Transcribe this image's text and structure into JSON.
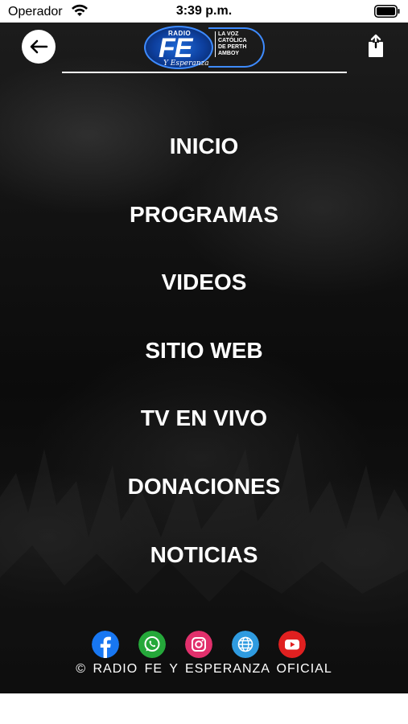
{
  "status_bar": {
    "carrier": "Operador",
    "time": "3:39 p.m."
  },
  "header": {
    "logo": {
      "radio": "RADIO",
      "fe": "FE",
      "esperanza": "Y Esperanza",
      "tagline": [
        "LA VOZ",
        "CATÓLICA",
        "DE PERTH",
        "AMBOY"
      ]
    }
  },
  "menu": {
    "items": [
      {
        "label": "INICIO"
      },
      {
        "label": "PROGRAMAS"
      },
      {
        "label": "VIDEOS"
      },
      {
        "label": "SITIO WEB"
      },
      {
        "label": "TV EN VIVO"
      },
      {
        "label": "DONACIONES"
      },
      {
        "label": "NOTICIAS"
      }
    ]
  },
  "social": [
    {
      "icon": "facebook-icon",
      "color": "#1877f2"
    },
    {
      "icon": "whatsapp-icon",
      "color": "#25a83a"
    },
    {
      "icon": "instagram-icon",
      "color": "#e1306c"
    },
    {
      "icon": "globe-icon",
      "color": "#2f9be0"
    },
    {
      "icon": "youtube-icon",
      "color": "#e02020"
    }
  ],
  "footer": {
    "copyright": "© RADIO FE Y ESPERANZA OFICIAL"
  }
}
